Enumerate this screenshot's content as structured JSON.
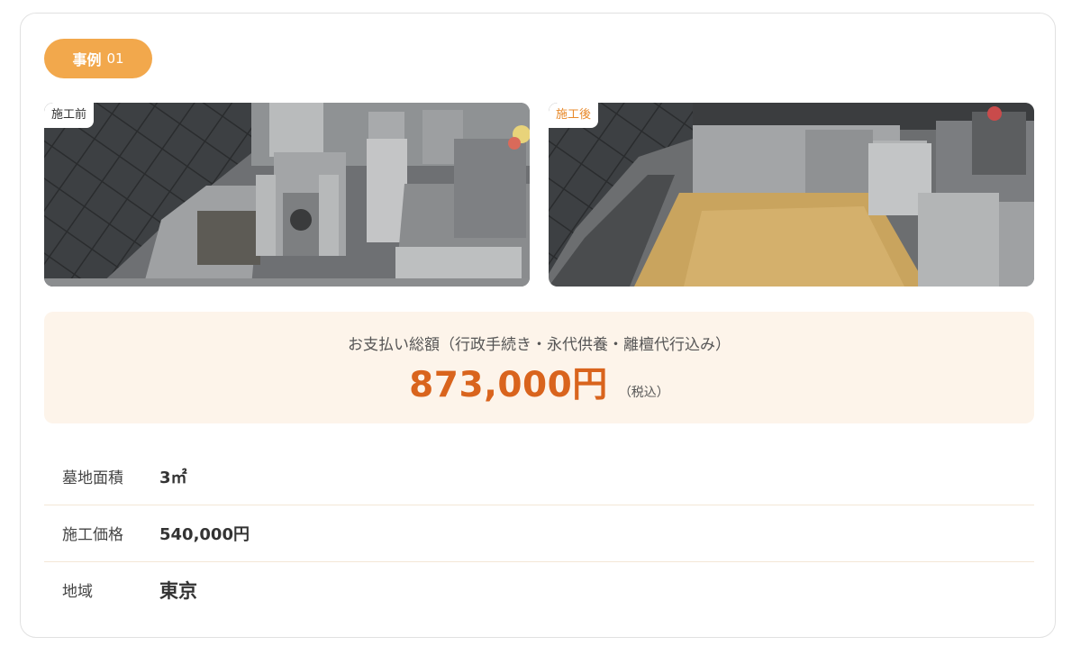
{
  "case_badge": {
    "word": "事例",
    "number": "01",
    "color": "#f2a84c"
  },
  "photos": {
    "before": {
      "tag": "施工前"
    },
    "after": {
      "tag": "施工後",
      "tag_color": "#e8892a"
    }
  },
  "payment": {
    "label": "お支払い総額（行政手続き・永代供養・離檀代行込み）",
    "amount": "873,000円",
    "tax_note": "（税込）",
    "amount_color": "#d9641d"
  },
  "specs": [
    {
      "label": "墓地面積",
      "value": "3㎡"
    },
    {
      "label": "施工価格",
      "value": "540,000円"
    },
    {
      "label": "地域",
      "value": "東京"
    }
  ]
}
